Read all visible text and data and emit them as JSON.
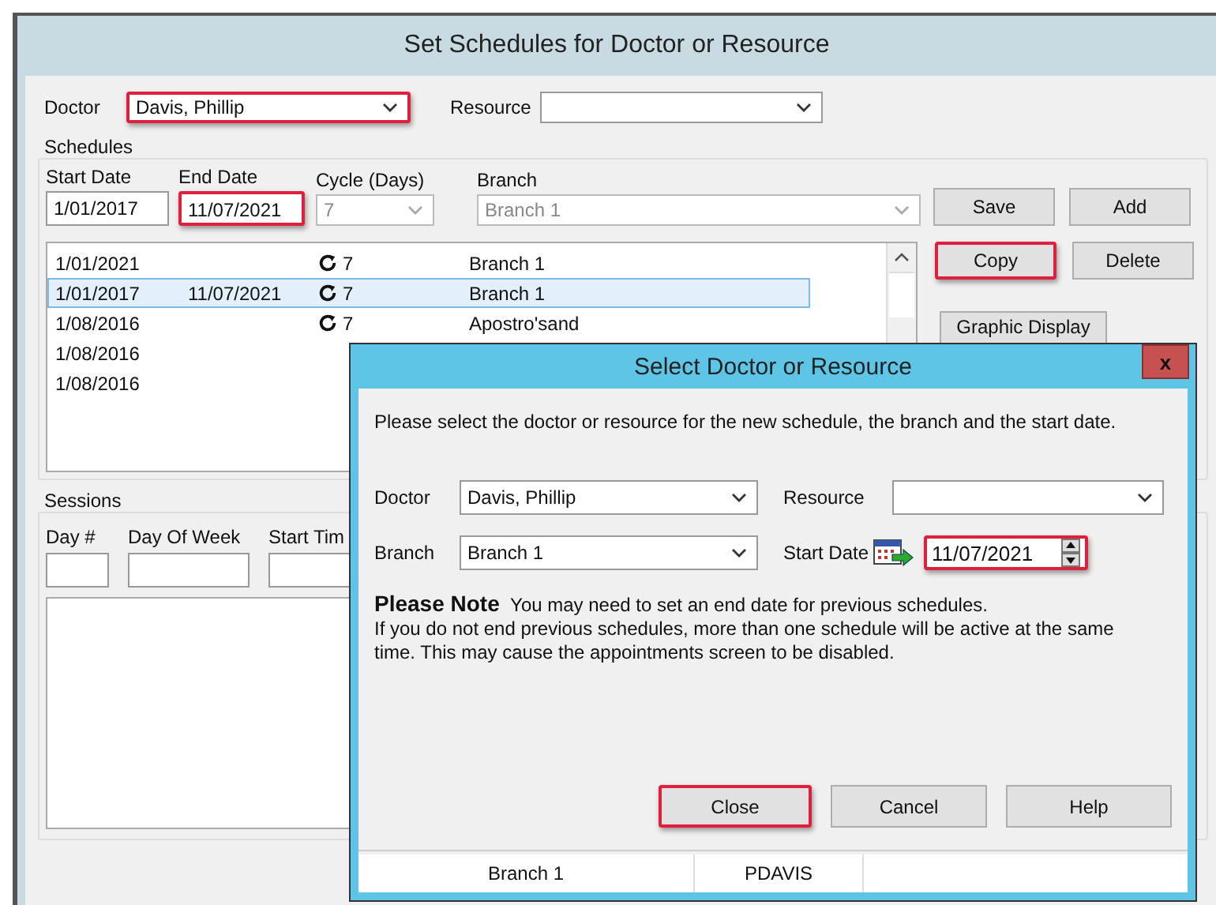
{
  "window": {
    "title": "Set Schedules for Doctor or Resource"
  },
  "doctor": {
    "label": "Doctor",
    "value": "Davis, Phillip",
    "highlighted": true
  },
  "resource": {
    "label": "Resource",
    "highlighted": false
  },
  "schedules": {
    "title": "Schedules",
    "fields": [
      {
        "label": "Start Date",
        "value": "1/01/2017",
        "kind": "text",
        "highlighted": false,
        "disabled": false
      },
      {
        "label": "End Date",
        "value": "11/07/2021",
        "kind": "text",
        "highlighted": true,
        "disabled": false
      },
      {
        "label": "Cycle (Days)",
        "value": "7",
        "kind": "select",
        "highlighted": false,
        "disabled": true
      },
      {
        "label": "Branch",
        "value": "Branch 1",
        "kind": "select",
        "highlighted": false,
        "disabled": true
      }
    ],
    "rows": [
      {
        "start": "1/01/2021",
        "end": "",
        "cycle": "7",
        "branch": "Branch 1",
        "selected": false
      },
      {
        "start": "1/01/2017",
        "end": "11/07/2021",
        "cycle": "7",
        "branch": "Branch 1",
        "selected": true
      },
      {
        "start": "1/08/2016",
        "end": "",
        "cycle": "7",
        "branch": "Apostro'sand",
        "selected": false
      },
      {
        "start": "1/08/2016",
        "end": "",
        "cycle": "",
        "branch": "",
        "selected": false
      },
      {
        "start": "1/08/2016",
        "end": "",
        "cycle": "",
        "branch": "",
        "selected": false
      }
    ],
    "buttons": [
      {
        "label": "Save",
        "highlighted": false
      },
      {
        "label": "Add",
        "highlighted": false
      },
      {
        "label": "Copy",
        "highlighted": true
      },
      {
        "label": "Delete",
        "highlighted": false
      }
    ],
    "graphic_button": "Graphic Display"
  },
  "sessions": {
    "title": "Sessions",
    "columns": [
      "Day #",
      "Day Of Week",
      "Start Tim"
    ]
  },
  "dialog": {
    "title": "Select Doctor or Resource",
    "close": "x",
    "instruction": "Please select the doctor or resource for the new schedule, the branch and the start date.",
    "doctor": {
      "label": "Doctor",
      "value": "Davis, Phillip"
    },
    "resource": {
      "label": "Resource"
    },
    "branch": {
      "label": "Branch",
      "value": "Branch 1"
    },
    "start_date": {
      "label": "Start Date",
      "value": "11/07/2021",
      "highlighted": true
    },
    "note_title": "Please Note",
    "note_line": "You may need to set an end date for previous schedules.",
    "note_body": "If you do not end previous schedules, more than one schedule will be active at the same time.  This may cause the appointments screen to be disabled.",
    "buttons": [
      {
        "label": "Close",
        "highlighted": true
      },
      {
        "label": "Cancel",
        "highlighted": false
      },
      {
        "label": "Help",
        "highlighted": false
      }
    ],
    "status_bar": [
      "Branch 1",
      "PDAVIS"
    ]
  }
}
